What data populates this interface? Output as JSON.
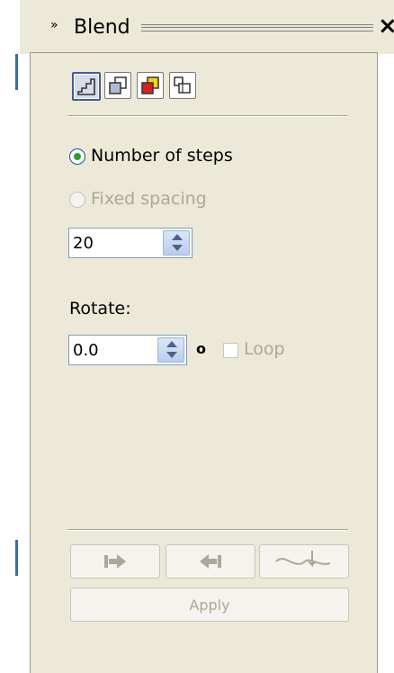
{
  "docker": {
    "title": "Blend",
    "collapse_glyph": "»",
    "close_glyph": "×"
  },
  "modes": [
    {
      "icon": "blend-steps-icon",
      "active": true
    },
    {
      "icon": "blend-overlap-icon",
      "active": false
    },
    {
      "icon": "blend-color-icon",
      "active": false
    },
    {
      "icon": "blend-misc-icon",
      "active": false
    }
  ],
  "steps_option": {
    "label": "Number of steps",
    "checked": true
  },
  "spacing_option": {
    "label": "Fixed spacing",
    "checked": false,
    "disabled": true
  },
  "steps_value": "20",
  "rotate": {
    "label": "Rotate:",
    "value": "0.0",
    "unit": "o",
    "loop_label": "Loop",
    "loop_checked": false
  },
  "actions": {
    "apply_label": "Apply"
  },
  "colors": {
    "panel_bg": "#ece9d8",
    "accent": "#3f5f96",
    "disabled_text": "#aca899",
    "radio_check": "#2f9e2f"
  }
}
